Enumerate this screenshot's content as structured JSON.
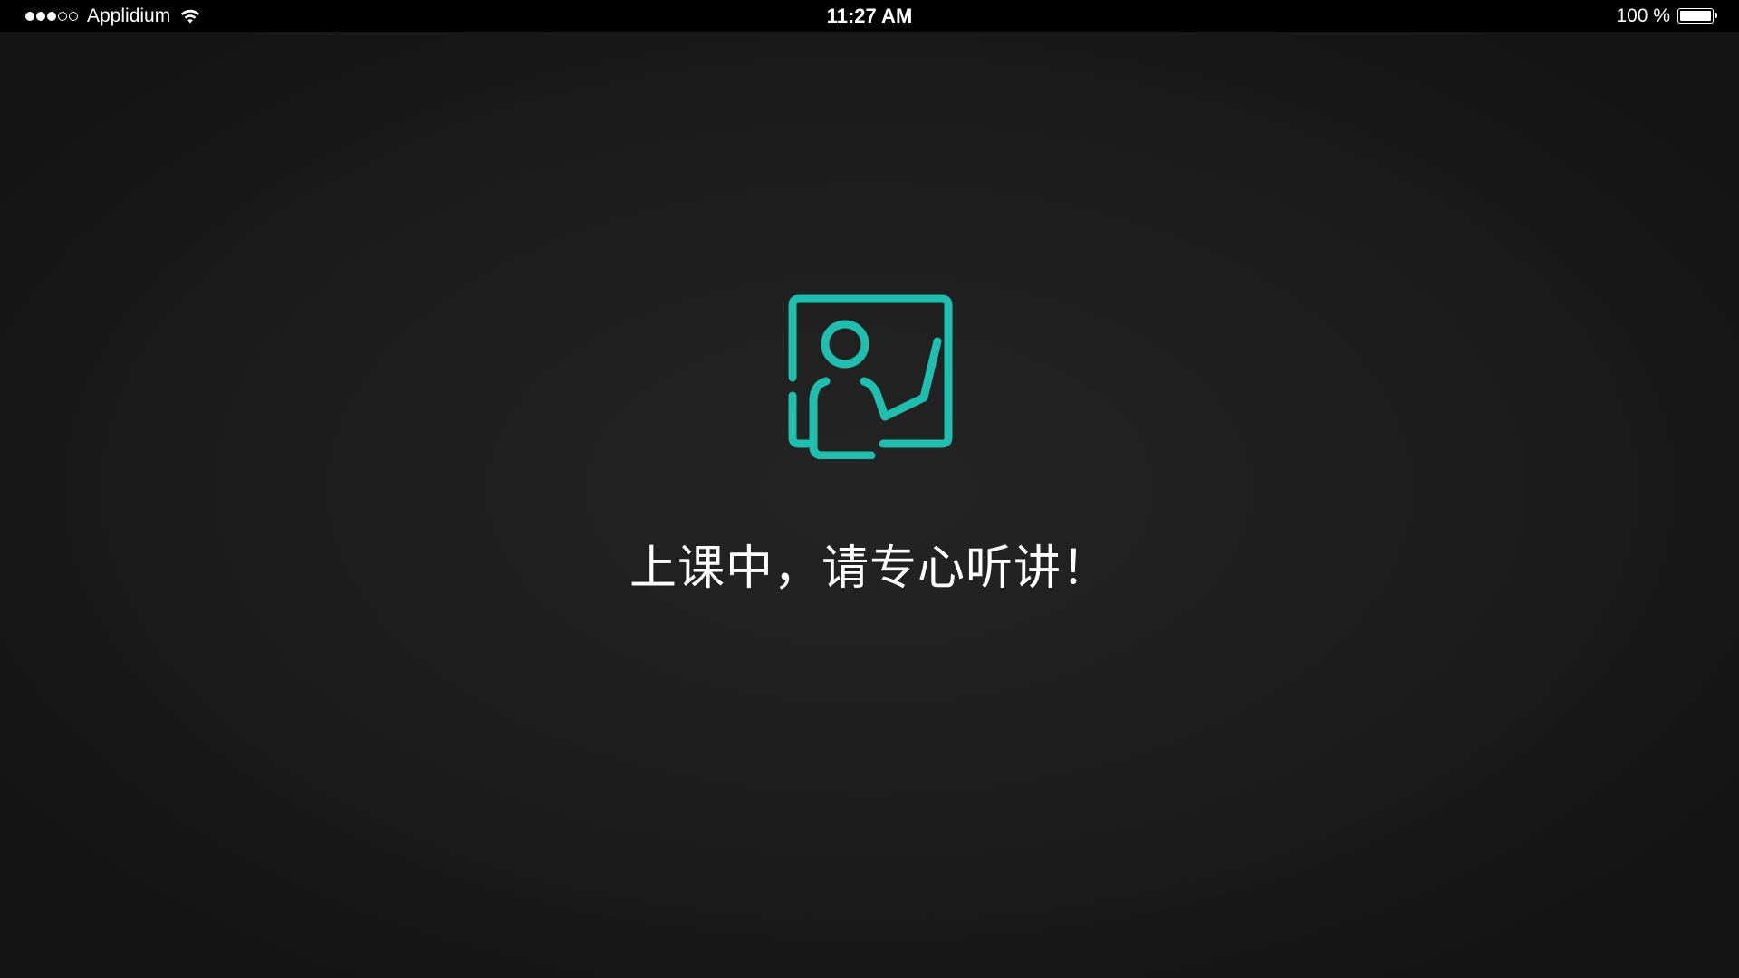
{
  "status_bar": {
    "signal_bars_filled": 3,
    "signal_bars_total": 5,
    "carrier": "Applidium",
    "wifi_icon": "wifi-icon",
    "time": "11:27 AM",
    "battery_percent_text": "100 %",
    "battery_level": 1.0
  },
  "main": {
    "icon": "teacher-at-board-icon",
    "icon_color": "#1fbfb0",
    "message": "上课中，请专心听讲！"
  },
  "colors": {
    "background": "#1e1e1e",
    "status_bar": "#000000",
    "text": "#ffffff",
    "accent": "#1fbfb0"
  }
}
